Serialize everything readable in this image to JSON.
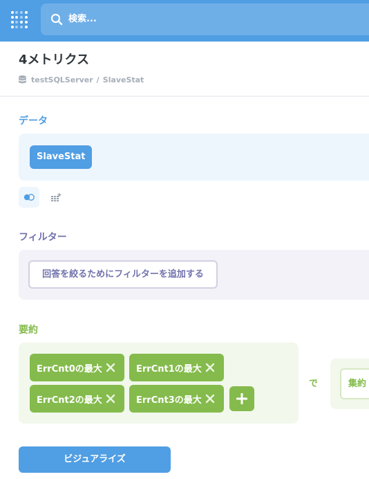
{
  "nav": {
    "search_placeholder": "検索..."
  },
  "header": {
    "title": "4メトリクス",
    "breadcrumb": {
      "database": "testSQLServer",
      "separator": "/",
      "table": "SlaveStat"
    }
  },
  "data_section": {
    "label": "データ",
    "table_name": "SlaveStat"
  },
  "filter_section": {
    "label": "フィルター",
    "add_filter_label": "回答を絞るためにフィルターを追加する"
  },
  "summarize_section": {
    "label": "要約",
    "metrics": [
      "ErrCnt0の最大",
      "ErrCnt1の最大",
      "ErrCnt2の最大",
      "ErrCnt3の最大"
    ],
    "by_label": "で",
    "group_by_label": "集約"
  },
  "visualize_label": "ビジュアライズ",
  "colors": {
    "brand": "#509ee3",
    "data": "#509ee3",
    "filter": "#7172ad",
    "summarize": "#84bb4c"
  }
}
